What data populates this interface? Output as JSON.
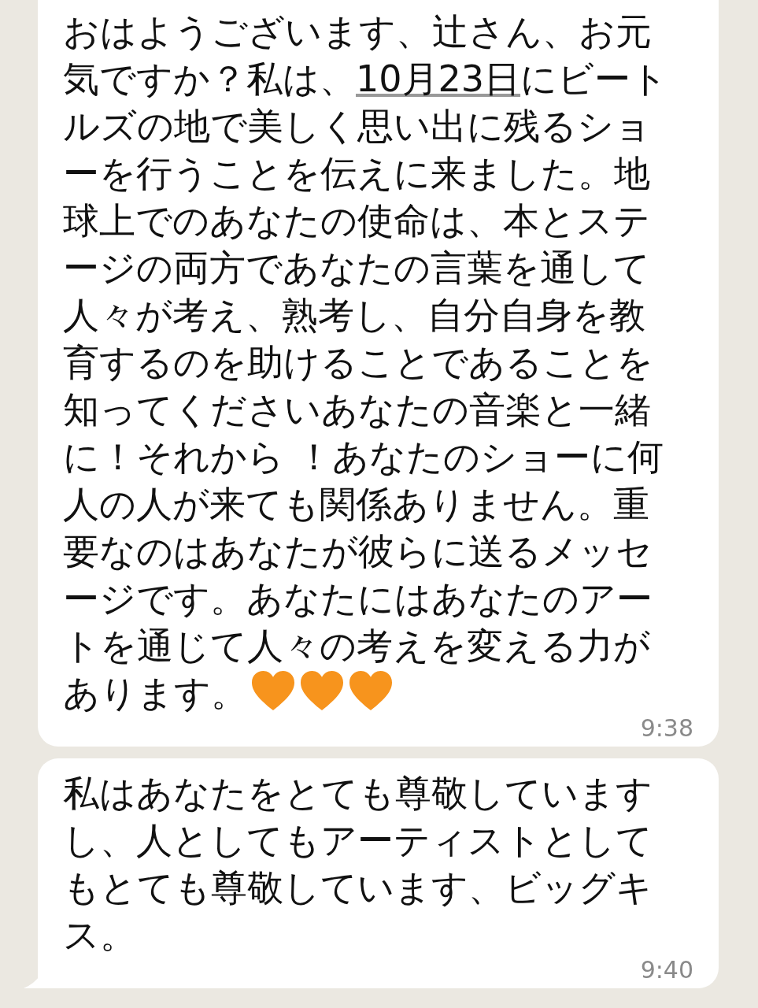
{
  "messages": [
    {
      "segments": [
        {
          "kind": "text",
          "text": "おはようございます、辻さん、お元気ですか？私は、"
        },
        {
          "kind": "link",
          "text": "10月23日"
        },
        {
          "kind": "text",
          "text": "にビートルズの地で美しく思い出に残るショーを行うことを伝えに来ました。地球上でのあなたの使命は、本とステージの両方であなたの言葉を通して人々が考え、熟考し、自分自身を教育するのを助けることであることを知ってくださいあなたの音楽と一緒に！それから ！あなたのショーに何人の人が来ても関係ありません。重要なのはあなたが彼らに送るメッセージです。あなたにはあなたのアートを通じて人々の考えを変える力があります。"
        }
      ],
      "emojis": [
        {
          "kind": "heart",
          "color": "#f7941d"
        },
        {
          "kind": "heart",
          "color": "#f7941d"
        },
        {
          "kind": "heart",
          "color": "#f7941d"
        }
      ],
      "time": "9:38",
      "tail": false
    },
    {
      "segments": [
        {
          "kind": "text",
          "text": "私はあなたをとても尊敬していますし、人としてもアーティストとしてもとても尊敬しています、ビッグキス。"
        }
      ],
      "time": "9:40",
      "tail": true
    }
  ]
}
